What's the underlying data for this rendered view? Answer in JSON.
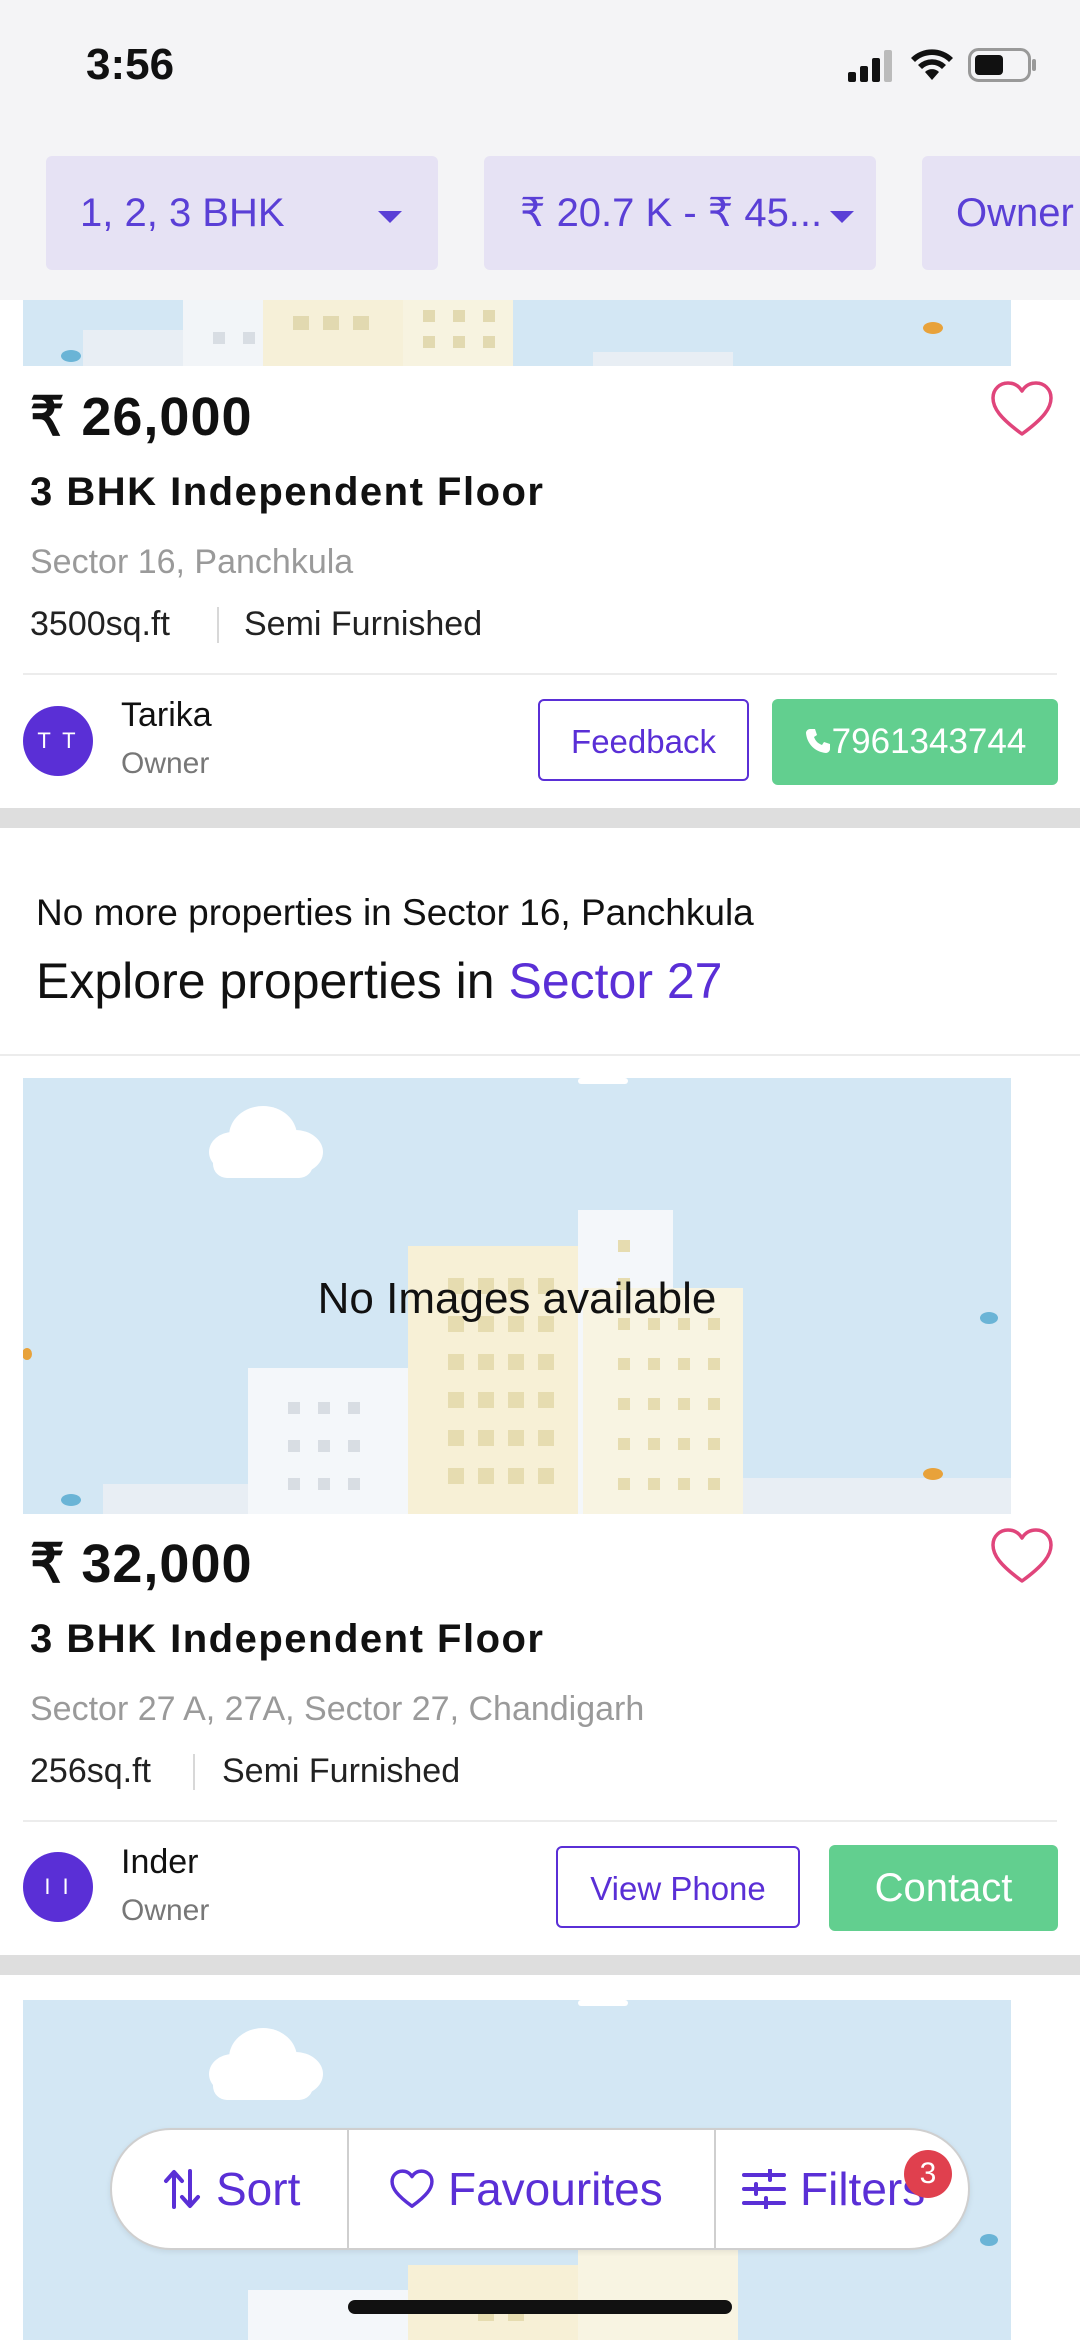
{
  "status_bar": {
    "time": "3:56"
  },
  "filters": {
    "bhk": "1, 2, 3 BHK",
    "price": "₹ 20.7 K - ₹ 45...",
    "posted_by": "Owner"
  },
  "cards": [
    {
      "price": "₹ 26,000",
      "type": "3 BHK Independent Floor",
      "location": "Sector 16, Panchkula",
      "area": "3500sq.ft",
      "furnishing": "Semi Furnished",
      "owner_initials": "T T",
      "owner_name": "Tarika",
      "owner_role": "Owner",
      "outline_button": "Feedback",
      "green_button": "7961343744"
    },
    {
      "no_image_text": "No Images available",
      "price": "₹ 32,000",
      "type": "3 BHK Independent Floor",
      "location": "Sector 27 A, 27A, Sector 27, Chandigarh",
      "area": "256sq.ft",
      "furnishing": "Semi Furnished",
      "owner_initials": "I I",
      "owner_name": "Inder",
      "owner_role": "Owner",
      "outline_button": "View Phone",
      "green_button": "Contact"
    }
  ],
  "explore": {
    "no_more": "No more properties in Sector 16, Panchkula",
    "prefix": "Explore properties in ",
    "link": "Sector 27"
  },
  "bottom_bar": {
    "sort": "Sort",
    "favourites": "Favourites",
    "filters": "Filters",
    "filters_count": "3"
  },
  "colors": {
    "accent": "#5a2fd6",
    "contact_green": "#62cf8f",
    "heart": "#e0457b",
    "badge": "#e0404e",
    "placeholder_sky": "#d3e7f4"
  }
}
